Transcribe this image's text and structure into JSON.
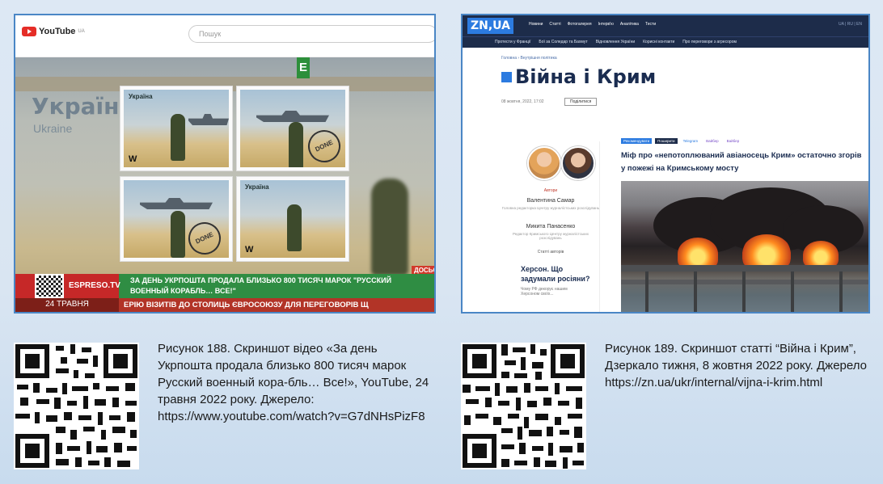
{
  "left_screenshot": {
    "youtube_logo": "YouTube",
    "youtube_logo_sup": "UA",
    "search_placeholder": "Пошук",
    "channel_letter": "E",
    "overlay_country": "Україна",
    "overlay_country_sub": "Ukraine",
    "stamp_label": "Україна",
    "stamp_value": "W",
    "stamp_done": "DONE",
    "dosie_badge": "ДОСЬЄ",
    "channel_name": "ESPRESO.TV",
    "headline": "ЗА ДЕНЬ УКРПОШТА ПРОДАЛА БЛИЗЬКО 800 ТИСЯЧ МАРОК \"РУССКИЙ ВОЕННЫЙ КОРАБЛЬ… ВСЕ!\"",
    "date": "24 ТРАВНЯ",
    "ticker": "ЕРІЮ ВІЗИТІВ ДО СТОЛИЦЬ ЄВРОСОЮЗУ ДЛЯ ПЕРЕГОВОРІВ Щ"
  },
  "right_screenshot": {
    "logo": "ZN,UA",
    "nav_items": [
      "Новини",
      "Статті",
      "Фотогалерея",
      "Інтерв'ю",
      "Аналітика",
      "Тести"
    ],
    "nav_right": "UA | RU | EN",
    "subnav_items": [
      "Протести у Франції",
      "Бої за Соледар та Бахмут",
      "Відновлення України",
      "Корисні контакти",
      "Про переговори з агресором"
    ],
    "breadcrumb": "Головна › Внутрішня політика",
    "title": "Війна і Крим",
    "date": "08 жовтня, 2022, 17:02",
    "share_label": "Поділитися",
    "authors_label": "Автори",
    "author1_name": "Валентина Самар",
    "author1_desc": "Головна редакторка Центру журналістських розслідувань",
    "author2_name": "Микита Панасенко",
    "author2_desc": "Редактор Кримського Центру журналістських розслідувань",
    "side_label": "Статті авторів",
    "side_article": "Херсон. Що задумали росіяни?",
    "side_article_sub": "Чому РФ декорує нашим Херсоном своїх...",
    "tags": [
      "Рекомендувати",
      "Поширити",
      "Telegram",
      "Вайбер",
      "Вайбер"
    ],
    "article_title": "Міф про «непотоплюваний авіаносець Крим» остаточно згорів у пожежі на Кримському мосту"
  },
  "captions": {
    "left": "Рисунок 188. Скриншот відео «За день Укрпошта продала близько 800 тисяч марок Русский военный кора-бль… Все!», YouTube, 24 травня 2022 року. Джерело: https://www.youtube.com/watch?v=G7dNHsPizF8",
    "right": "Рисунок 189. Скриншот статті “Війна і Крим”, Дзеркало тижня, 8 жовтня 2022 року. Джерело https://zn.ua/ukr/internal/vijna-i-krim.html"
  },
  "colors": {
    "frame_border": "#4a86c5",
    "espreso_green": "#2f8d43",
    "espreso_red": "#c62828",
    "zn_navy": "#1d2c4a",
    "zn_blue": "#2c7be0"
  }
}
